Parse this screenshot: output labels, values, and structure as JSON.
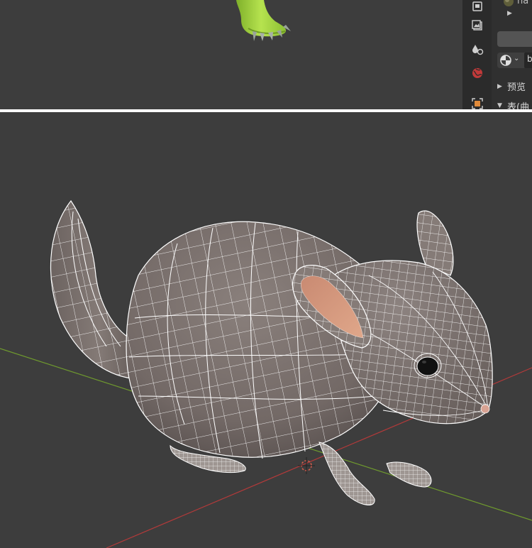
{
  "properties_panel": {
    "material_name_fragment": "ha",
    "mode_field_fragment": "b",
    "preview_label": "预览",
    "surface_label": "表(曲"
  },
  "icons": {
    "tab_render": "render-icon",
    "tab_output": "output-image-icon",
    "tab_physics": "physics-drops-icon",
    "tab_world": "world-icon",
    "tab_object": "object-constraint-icon",
    "material_sphere": "material-sphere-icon",
    "shading_mode": "shading-sphere-icon"
  },
  "colors": {
    "viewport_bg": "#3d3d3d",
    "mesh_fill": "#7c716d",
    "wire": "#ffffff",
    "ear_inner": "#d8987c",
    "x_axis": "#b23a3a",
    "y_axis": "#6f9a2e",
    "green_model": "#a8d94a"
  }
}
